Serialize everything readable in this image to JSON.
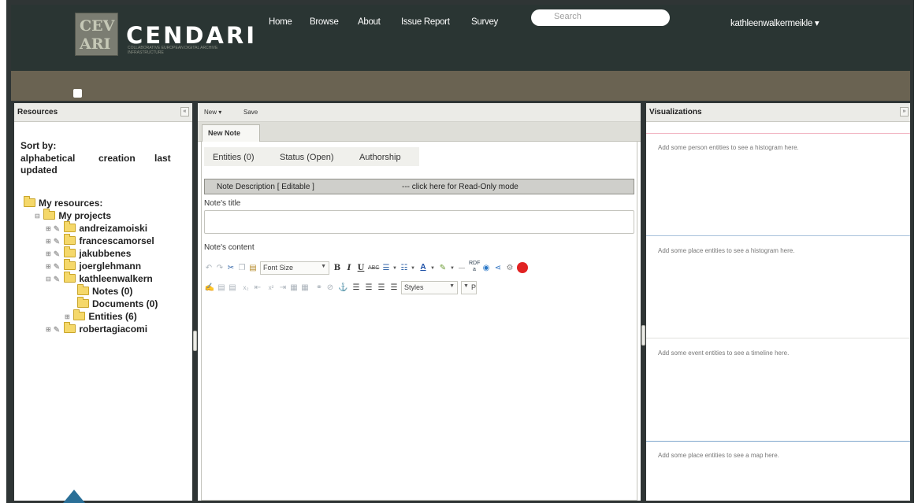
{
  "brand": {
    "logo_letters": [
      "CEV",
      "ARI"
    ],
    "title": "CENDARI",
    "tagline": "COLLABORATIVE EUROPEAN DIGITAL ARCHIVE INFRASTRUCTURE"
  },
  "nav": {
    "items": [
      "Home",
      "Browse",
      "About",
      "Issue Report",
      "Survey"
    ],
    "search_placeholder": "Search",
    "user": "kathleenwalkermeikle ▾"
  },
  "resources": {
    "title": "Resources",
    "collapse_glyph": "«",
    "sort_label": "Sort by:",
    "sort_options": [
      "alphabetical",
      "creation",
      "last",
      "updated"
    ],
    "tree": {
      "root": "My resources:",
      "projects": "My projects",
      "items": [
        "andreizamoiski",
        "francescamorsel",
        "jakubbenes",
        "joerglehmann",
        "kathleenwalkern",
        "Notes (0)",
        "Documents (0)",
        "Entities (6)",
        "robertagiacomi"
      ]
    }
  },
  "note": {
    "new_menu": "New ▾",
    "save": "Save",
    "tab": "New Note",
    "subtabs": [
      "Entities (0)",
      "Status (Open)",
      "Authorship"
    ],
    "desc_left": "Note Description [ Editable ]",
    "desc_right": "--- click here for Read-Only mode",
    "title_label": "Note's title",
    "title_value": "",
    "content_label": "Note's content",
    "font_size": "Font Size",
    "styles": "Styles",
    "format_short": "P"
  },
  "visualizations": {
    "title": "Visualizations",
    "collapse_glyph": "»",
    "messages": [
      "Add some person entities to see a histogram here.",
      "Add some place entities to see a histogram here.",
      "Add some event entities to see a timeline here.",
      "Add some place entities to see a map here."
    ],
    "line_colors": [
      "#f2b6c4",
      "#a9c2dc",
      "#e1e1dd",
      "#7ea6cc"
    ]
  },
  "colors": {
    "topbar": "#2a3533",
    "band": "#6a6352",
    "frame": "#2f3535",
    "record_dot": "#e12222"
  }
}
